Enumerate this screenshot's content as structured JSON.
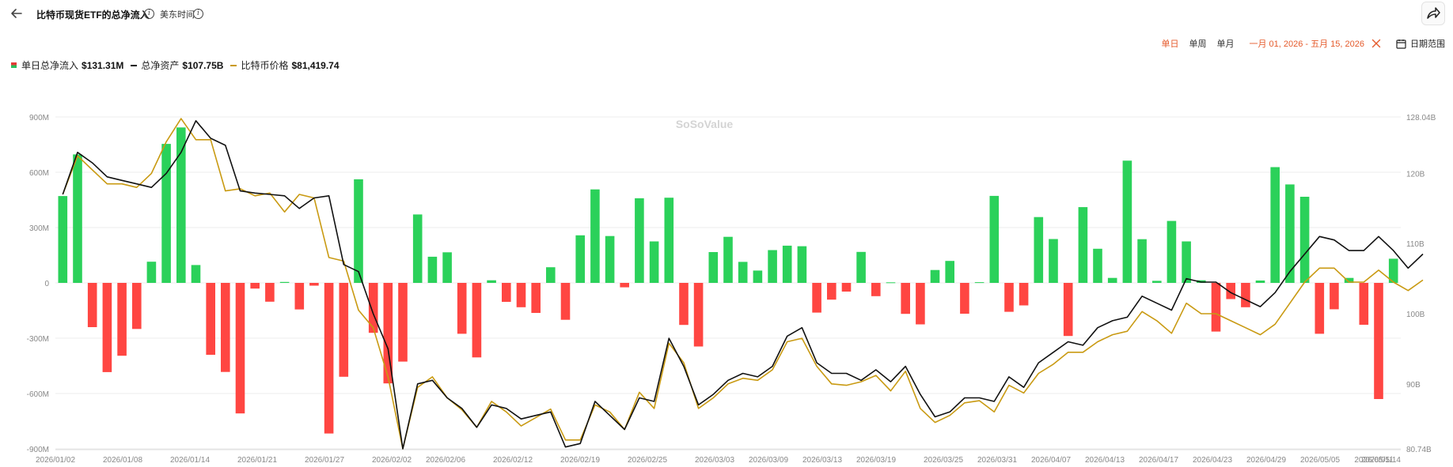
{
  "header": {
    "title": "比特币现货ETF的总净流入",
    "timezone": "美东时间"
  },
  "controls": {
    "tabs": [
      "单日",
      "单周",
      "单月"
    ],
    "active_tab": "单日",
    "range": "一月 01, 2026 - 五月 15, 2026",
    "date_range_label": "日期范围"
  },
  "legend": {
    "inflow_label": "单日总净流入",
    "inflow_value": "$131.31M",
    "assets_label": "总净资产",
    "assets_value": "$107.75B",
    "price_label": "比特币价格",
    "price_value": "$81,419.74"
  },
  "watermark": "SoSoValue",
  "colors": {
    "positive": "#2bd15a",
    "negative": "#ff4642",
    "assets_line": "#111111",
    "price_line": "#c99a12",
    "accent": "#e55a2b"
  },
  "chart_data": {
    "type": "bar",
    "x_tick_labels": [
      "2026/01/02",
      "2026/01/08",
      "2026/01/14",
      "2026/01/21",
      "2026/01/27",
      "2026/02/02",
      "2026/02/06",
      "2026/02/12",
      "2026/02/19",
      "2026/02/25",
      "2026/03/03",
      "2026/03/09",
      "2026/03/13",
      "2026/03/19",
      "2026/03/25",
      "2026/03/31",
      "2026/04/07",
      "2026/04/13",
      "2026/04/17",
      "2026/04/23",
      "2026/04/29",
      "2026/05/05",
      "2026/05/11",
      "2026/05/14"
    ],
    "left_axis": {
      "ticks": [
        "900M",
        "600M",
        "300M",
        "0",
        "-300M",
        "-600M",
        "-900M"
      ],
      "min": -900,
      "max": 900,
      "unit": "M"
    },
    "right_axis": {
      "ticks": [
        "128.04B",
        "120B",
        "110B",
        "100B",
        "90B",
        "80.74B"
      ],
      "min": 80.74,
      "max": 128.04,
      "unit": "B"
    },
    "grid": true,
    "series": [
      {
        "name": "单日总净流入",
        "type": "bar",
        "axis": "left",
        "values": [
          471,
          697,
          -240,
          -484,
          -395,
          -250,
          115,
          754,
          843,
          97,
          -390,
          -483,
          -708,
          -31,
          -102,
          5,
          -144,
          -15,
          -817,
          -509,
          562,
          -271,
          -545,
          -427,
          371,
          142,
          166,
          -276,
          -404,
          14,
          -103,
          -132,
          -163,
          85,
          -200,
          258,
          507,
          254,
          -24,
          459,
          225,
          462,
          -228,
          -345,
          167,
          250,
          114,
          67,
          178,
          202,
          199,
          -161,
          -91,
          -47,
          168,
          -72,
          3,
          -168,
          -225,
          70,
          119,
          -167,
          4,
          472,
          -157,
          -122,
          357,
          238,
          -288,
          411,
          185,
          27,
          663,
          237,
          11,
          336,
          225,
          14,
          -264,
          -88,
          -132,
          13,
          628,
          534,
          467,
          -276,
          -143,
          27,
          -227,
          -630,
          131
        ]
      },
      {
        "name": "总净资产",
        "type": "line",
        "axis": "right",
        "values": [
          117,
          123,
          121.5,
          119.5,
          119,
          118.5,
          118,
          120,
          123,
          127.5,
          125,
          124,
          117.5,
          117.2,
          117,
          116.8,
          115,
          116.5,
          116.8,
          107,
          106,
          100,
          95,
          80.74,
          90,
          90.5,
          88,
          86.5,
          83.8,
          87,
          86.5,
          85,
          85.5,
          86,
          81,
          81.5,
          87.5,
          85.5,
          83.5,
          88,
          87.5,
          96.5,
          92.5,
          87,
          88.5,
          90.5,
          91.5,
          91,
          92.5,
          96.8,
          98,
          93,
          91.5,
          91.5,
          90.5,
          92,
          90.3,
          92.5,
          88.5,
          85.3,
          86,
          88,
          88,
          87.5,
          91,
          89.5,
          93,
          94.5,
          96,
          95.5,
          98,
          99,
          99.5,
          102.5,
          101.5,
          100.5,
          105,
          104.5,
          104.5,
          103,
          102,
          101,
          103,
          106,
          108.5,
          111,
          110.5,
          109,
          109,
          111,
          109,
          106.5,
          108.5
        ]
      },
      {
        "name": "比特币价格",
        "type": "line",
        "axis": "right",
        "values": [
          117,
          122.5,
          120.5,
          118.5,
          118.5,
          118,
          120,
          124.5,
          127.8,
          124.8,
          124.8,
          117.5,
          117.8,
          116.8,
          117.2,
          114.5,
          117,
          116.5,
          108,
          107.5,
          100.5,
          98,
          91,
          80.74,
          89.5,
          91,
          88,
          86.3,
          83.8,
          87.5,
          86,
          84,
          85.2,
          86.4,
          82,
          82,
          87,
          86,
          83.5,
          88.8,
          86.5,
          95.8,
          93,
          86.5,
          88,
          90,
          90.8,
          90.5,
          92,
          96,
          96.5,
          92.5,
          90,
          89.8,
          90.3,
          91.2,
          89,
          91.8,
          86.5,
          84.5,
          85.5,
          87.3,
          87.6,
          86,
          89.8,
          88.7,
          91.5,
          92.8,
          94.5,
          94.5,
          96,
          97,
          97.5,
          100.3,
          99,
          97.2,
          101.5,
          100,
          100,
          99,
          98,
          97,
          98.5,
          101.5,
          104.5,
          106.5,
          106.5,
          104.5,
          104.5,
          106.2,
          104.5,
          103.3,
          104.8
        ]
      }
    ]
  }
}
